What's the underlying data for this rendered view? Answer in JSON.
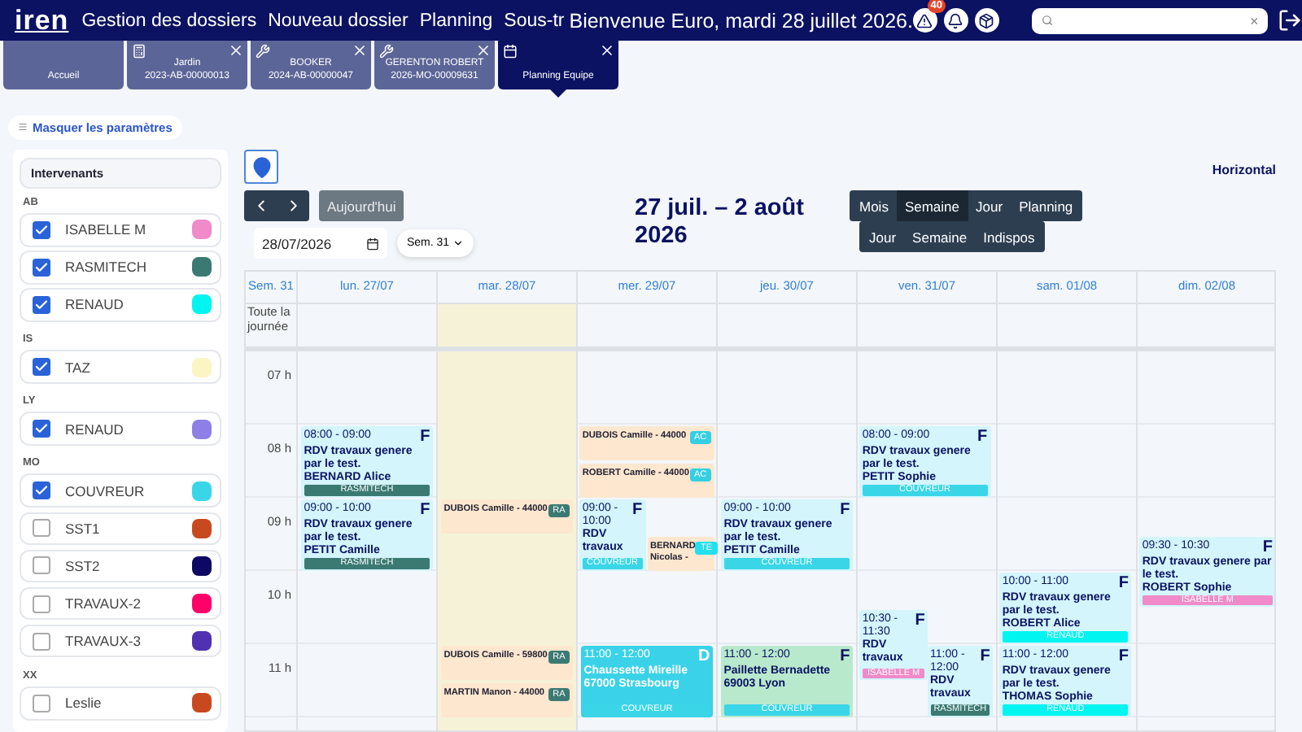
{
  "header": {
    "logo": "iren",
    "nav": [
      "Gestion des dossiers",
      "Nouveau dossier",
      "Planning",
      "Sous-tr"
    ],
    "welcome": "Bienvenue Euro, mardi 28 juillet 2026.",
    "alerts_badge": "40",
    "search": {
      "clear": "×"
    }
  },
  "tabs": [
    {
      "kind": "home",
      "title": "Accueil",
      "selected": false
    },
    {
      "kind": "calculator",
      "title": "Jardin",
      "subtitle": "2023-AB-00000013",
      "selected": false
    },
    {
      "kind": "wrench",
      "title": "BOOKER",
      "subtitle": "2024-AB-00000047",
      "selected": false
    },
    {
      "kind": "wrench",
      "title": "GERENTON ROBERT",
      "subtitle": "2026-MO-00009631",
      "selected": false
    },
    {
      "kind": "calendar",
      "title": "Planning Equipe",
      "selected": true
    }
  ],
  "toggle_params": "Masquer les paramètres",
  "sidebar": {
    "title": "Intervenants",
    "groups": [
      {
        "label": "AB",
        "items": [
          {
            "name": "ISABELLE M",
            "checked": true,
            "color": "#f08ac8"
          },
          {
            "name": "RASMITECH",
            "checked": true,
            "color": "#3b7a73"
          },
          {
            "name": "RENAUD",
            "checked": true,
            "color": "#00f5f0"
          }
        ]
      },
      {
        "label": "IS",
        "items": [
          {
            "name": "TAZ",
            "checked": true,
            "color": "#fbf5c4"
          }
        ]
      },
      {
        "label": "LY",
        "items": [
          {
            "name": "RENAUD",
            "checked": true,
            "color": "#8e7fe6"
          }
        ]
      },
      {
        "label": "MO",
        "items": [
          {
            "name": "COUVREUR",
            "checked": true,
            "color": "#3ad6e8"
          },
          {
            "name": "SST1",
            "checked": false,
            "color": "#c8491f"
          },
          {
            "name": "SST2",
            "checked": false,
            "color": "#0d0862"
          },
          {
            "name": "TRAVAUX-2",
            "checked": false,
            "color": "#ff0068"
          },
          {
            "name": "TRAVAUX-3",
            "checked": false,
            "color": "#4f31b2"
          }
        ]
      },
      {
        "label": "XX",
        "items": [
          {
            "name": "Leslie",
            "checked": false,
            "color": "#c8491f"
          }
        ]
      }
    ]
  },
  "toolbar": {
    "orientation": "Horizontal",
    "today": "Aujourd'hui",
    "date": "28/07/2026",
    "week_select": "Sem. 31",
    "title": "27 juil. – 2 août 2026",
    "views": [
      {
        "label": "Mois",
        "selected": false
      },
      {
        "label": "Semaine",
        "selected": true
      },
      {
        "label": "Jour",
        "selected": false
      },
      {
        "label": "Planning",
        "selected": false
      }
    ],
    "modes": [
      {
        "label": "Jour",
        "selected": false
      },
      {
        "label": "Semaine",
        "selected": false
      },
      {
        "label": "Indispos",
        "selected": false
      }
    ]
  },
  "calendar": {
    "week": "Sem. 31",
    "all_day": "Toute la journée",
    "hours": [
      "07 h",
      "08 h",
      "09 h",
      "10 h",
      "11 h"
    ],
    "days": [
      {
        "label": "lun. 27/07",
        "today": false,
        "events": [
          {
            "kind": "rdv",
            "color": "#d3f5fb",
            "time": "08:00 - 09:00",
            "badge": "F",
            "title": "RDV travaux genere par le test.",
            "name": "BERNARD Alice",
            "tag": {
              "text": "RASMITECH",
              "color": "#3b7a73"
            }
          },
          {
            "kind": "rdv",
            "color": "#d3f5fb",
            "time": "09:00 - 10:00",
            "badge": "F",
            "title": "RDV travaux genere par le test.",
            "name": "PETIT Camille",
            "tag": {
              "text": "RASMITECH",
              "color": "#3b7a73"
            }
          }
        ]
      },
      {
        "label": "mar. 28/07",
        "today": true,
        "events": [
          {
            "kind": "chip",
            "label": "DUBOIS Camille - 44000",
            "code": {
              "text": "RA",
              "color": "#3b7a73"
            }
          },
          {
            "kind": "chip",
            "label": "DUBOIS Camille - 59800",
            "code": {
              "text": "RA",
              "color": "#3b7a73"
            }
          },
          {
            "kind": "chip",
            "label": "MARTIN Manon - 44000",
            "code": {
              "text": "RA",
              "color": "#3b7a73"
            }
          }
        ]
      },
      {
        "label": "mer. 29/07",
        "today": false,
        "events": [
          {
            "kind": "chip",
            "label": "DUBOIS Camille - 44000",
            "code": {
              "text": "AC",
              "color": "#35cfe3"
            }
          },
          {
            "kind": "chip",
            "label": "ROBERT Camille - 44000",
            "code": {
              "text": "AC",
              "color": "#35cfe3"
            }
          },
          {
            "kind": "rdv",
            "color": "#d3f5fb",
            "time": "09:00 - 10:00",
            "badge": "F",
            "title": "RDV travaux",
            "tag": {
              "text": "COUVREUR",
              "color": "#3ad6e8"
            }
          },
          {
            "kind": "chip",
            "label": "BERNARD Nicolas -",
            "code": {
              "text": "TE",
              "color": "#22e0ee"
            }
          },
          {
            "kind": "rdv",
            "color": "#3ad2e8",
            "time": "11:00 - 12:00",
            "badge": "D",
            "title": "Chaussette Mireille 67000 Strasbourg",
            "tag": {
              "text": "COUVREUR",
              "color": "#3ad6e8"
            }
          }
        ]
      },
      {
        "label": "jeu. 30/07",
        "today": false,
        "events": [
          {
            "kind": "rdv",
            "color": "#d3f5fb",
            "time": "09:00 - 10:00",
            "badge": "F",
            "title": "RDV travaux genere par le test.",
            "name": "PETIT Camille",
            "tag": {
              "text": "COUVREUR",
              "color": "#3ad6e8"
            }
          },
          {
            "kind": "rdv",
            "color": "#b9e9cc",
            "time": "11:00 - 12:00",
            "badge": "F",
            "title": "Paillette Bernadette 69003 Lyon",
            "tag": {
              "text": "COUVREUR",
              "color": "#3ad6e8"
            }
          }
        ]
      },
      {
        "label": "ven. 31/07",
        "today": false,
        "events": [
          {
            "kind": "rdv",
            "color": "#d3f5fb",
            "time": "08:00 - 09:00",
            "badge": "F",
            "title": "RDV travaux genere par le test.",
            "name": "PETIT Sophie",
            "tag": {
              "text": "COUVREUR",
              "color": "#3ad6e8"
            }
          },
          {
            "kind": "rdv",
            "color": "#d3f5fb",
            "time": "10:30 - 11:30",
            "badge": "F",
            "title": "RDV travaux",
            "tag": {
              "text": "ISABELLE M",
              "color": "#f08ac8"
            }
          },
          {
            "kind": "rdv",
            "color": "#d3f5fb",
            "time": "11:00 - 12:00",
            "badge": "F",
            "title": "RDV travaux",
            "tag": {
              "text": "RASMITECH",
              "color": "#3b7a73"
            }
          }
        ]
      },
      {
        "label": "sam. 01/08",
        "today": false,
        "events": [
          {
            "kind": "rdv",
            "color": "#d3f5fb",
            "time": "10:00 - 11:00",
            "badge": "F",
            "title": "RDV travaux genere par le test.",
            "name": "ROBERT Alice",
            "tag": {
              "text": "RENAUD",
              "color": "#00f5f0"
            }
          },
          {
            "kind": "rdv",
            "color": "#d3f5fb",
            "time": "11:00 - 12:00",
            "badge": "F",
            "title": "RDV travaux genere par le test.",
            "name": "THOMAS Sophie",
            "tag": {
              "text": "RENAUD",
              "color": "#00f5f0"
            }
          }
        ]
      },
      {
        "label": "dim. 02/08",
        "today": false,
        "events": [
          {
            "kind": "rdv",
            "color": "#d3f5fb",
            "time": "09:30 - 10:30",
            "badge": "F",
            "title": "RDV travaux genere par le test.",
            "name": "ROBERT Sophie",
            "tag": {
              "text": "ISABELLE M",
              "color": "#f08ac8"
            }
          }
        ]
      }
    ]
  }
}
